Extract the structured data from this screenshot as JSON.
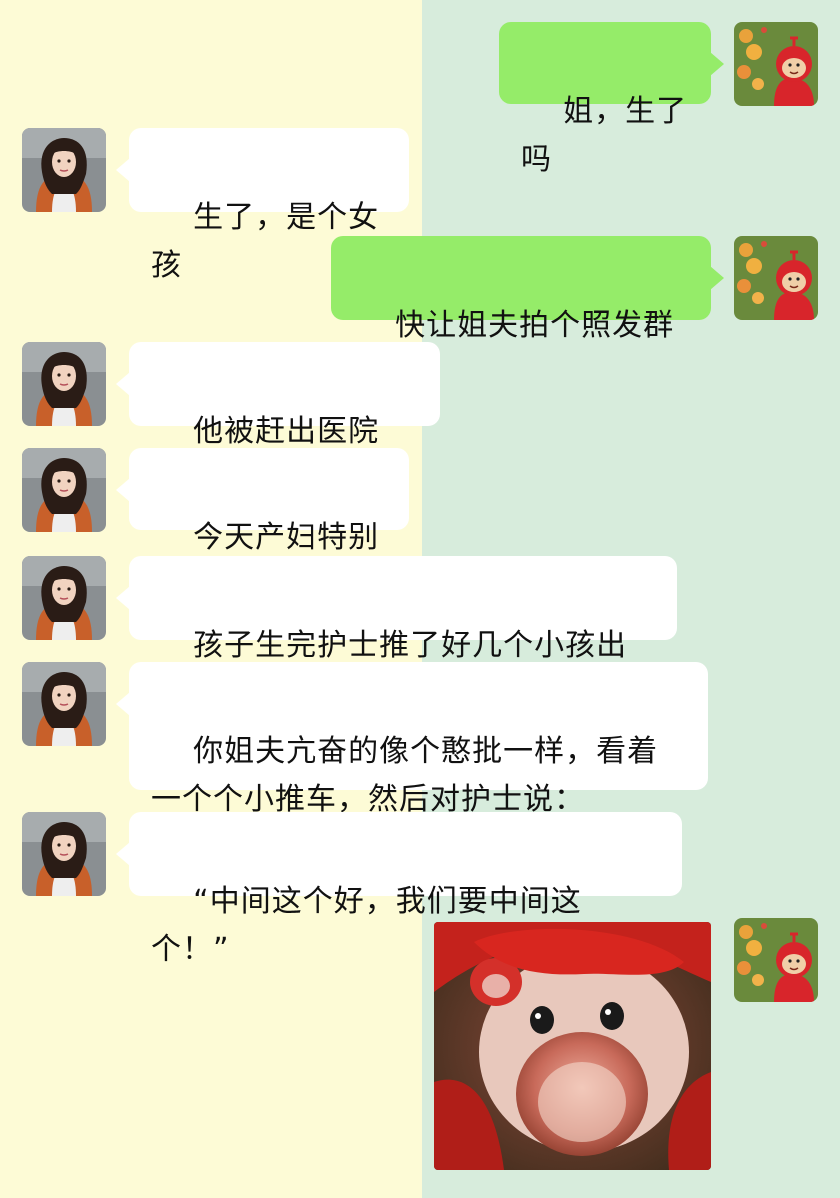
{
  "chat": {
    "messages": [
      {
        "side": "out",
        "text": "姐，生了吗"
      },
      {
        "side": "in",
        "text": "生了，是个女孩"
      },
      {
        "side": "out",
        "text": "快让姐夫拍个照发群里"
      },
      {
        "side": "in",
        "text": "他被赶出医院了..."
      },
      {
        "side": "in",
        "text": "今天产妇特别多"
      },
      {
        "side": "in",
        "text": "孩子生完护士推了好几个小孩出来"
      },
      {
        "side": "in",
        "text": "你姐夫亢奋的像个憨批一样，看着\n一个个小推车，然后对护士说："
      },
      {
        "side": "in",
        "text": "“中间这个好，我们要中间这个！”"
      },
      {
        "side": "out",
        "type": "sticker",
        "sticker": "screaming-hamster-sticker"
      }
    ]
  },
  "avatars": {
    "contact": "girl-portrait-avatar",
    "self": "red-teletubby-avatar"
  },
  "colors": {
    "left_background": "#fdfbd6",
    "right_background": "#d7ecdc",
    "incoming_bubble": "#ffffff",
    "outgoing_bubble": "#95ec69",
    "text": "#111111"
  }
}
